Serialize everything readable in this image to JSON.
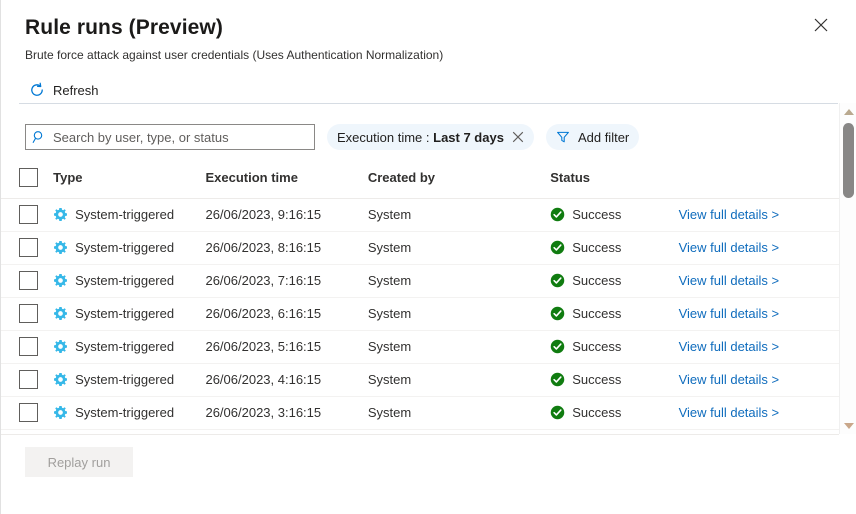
{
  "header": {
    "title": "Rule runs (Preview)",
    "subtitle": "Brute force attack against user credentials (Uses Authentication Normalization)",
    "close_label": "Close"
  },
  "commandbar": {
    "refresh_label": "Refresh"
  },
  "search": {
    "placeholder": "Search by user, type, or status",
    "value": ""
  },
  "filters": {
    "execution_time": {
      "key": "Execution time :",
      "value": "Last 7 days"
    },
    "add_filter_label": "Add filter"
  },
  "table": {
    "columns": [
      {
        "key": "check",
        "label": ""
      },
      {
        "key": "type",
        "label": "Type"
      },
      {
        "key": "time",
        "label": "Execution time"
      },
      {
        "key": "by",
        "label": "Created by"
      },
      {
        "key": "status",
        "label": "Status"
      },
      {
        "key": "link",
        "label": ""
      }
    ],
    "rows": [
      {
        "type": "System-triggered",
        "time": "26/06/2023, 9:16:15",
        "created_by": "System",
        "status": "Success",
        "link": "View full details >"
      },
      {
        "type": "System-triggered",
        "time": "26/06/2023, 8:16:15",
        "created_by": "System",
        "status": "Success",
        "link": "View full details >"
      },
      {
        "type": "System-triggered",
        "time": "26/06/2023, 7:16:15",
        "created_by": "System",
        "status": "Success",
        "link": "View full details >"
      },
      {
        "type": "System-triggered",
        "time": "26/06/2023, 6:16:15",
        "created_by": "System",
        "status": "Success",
        "link": "View full details >"
      },
      {
        "type": "System-triggered",
        "time": "26/06/2023, 5:16:15",
        "created_by": "System",
        "status": "Success",
        "link": "View full details >"
      },
      {
        "type": "System-triggered",
        "time": "26/06/2023, 4:16:15",
        "created_by": "System",
        "status": "Success",
        "link": "View full details >"
      },
      {
        "type": "System-triggered",
        "time": "26/06/2023, 3:16:15",
        "created_by": "System",
        "status": "Success",
        "link": "View full details >"
      }
    ]
  },
  "footer": {
    "replay_label": "Replay run"
  },
  "colors": {
    "accent": "#0078d4",
    "link": "#0f6cbd",
    "gear": "#36b8e8",
    "success": "#107c10",
    "chip_bg": "#eff6fc"
  }
}
